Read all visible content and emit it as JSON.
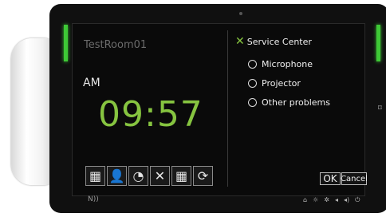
{
  "room": {
    "name": "TestRoom01"
  },
  "clock": {
    "ampm": "AM",
    "time": "09:57"
  },
  "toolbar": [
    {
      "name": "calendar-icon",
      "glyph": "▦"
    },
    {
      "name": "person-icon",
      "glyph": "👤"
    },
    {
      "name": "timer-icon",
      "glyph": "◔"
    },
    {
      "name": "tools-icon",
      "glyph": "✕"
    },
    {
      "name": "calendar-cancel-icon",
      "glyph": "▦"
    },
    {
      "name": "refresh-icon",
      "glyph": "⟳"
    }
  ],
  "service": {
    "title": "Service Center",
    "options": [
      "Microphone",
      "Projector",
      "Other problems"
    ],
    "ok_label": "OK",
    "cancel_label": "Cancel"
  },
  "colors": {
    "accent": "#86c440",
    "led": "#3ec936",
    "room_text": "#6b6b6b"
  },
  "hardware": {
    "nfc_label": "N))",
    "system_icons": [
      "home-icon",
      "brightness-down-icon",
      "brightness-up-icon",
      "volume-down-icon",
      "volume-up-icon",
      "power-icon"
    ]
  }
}
